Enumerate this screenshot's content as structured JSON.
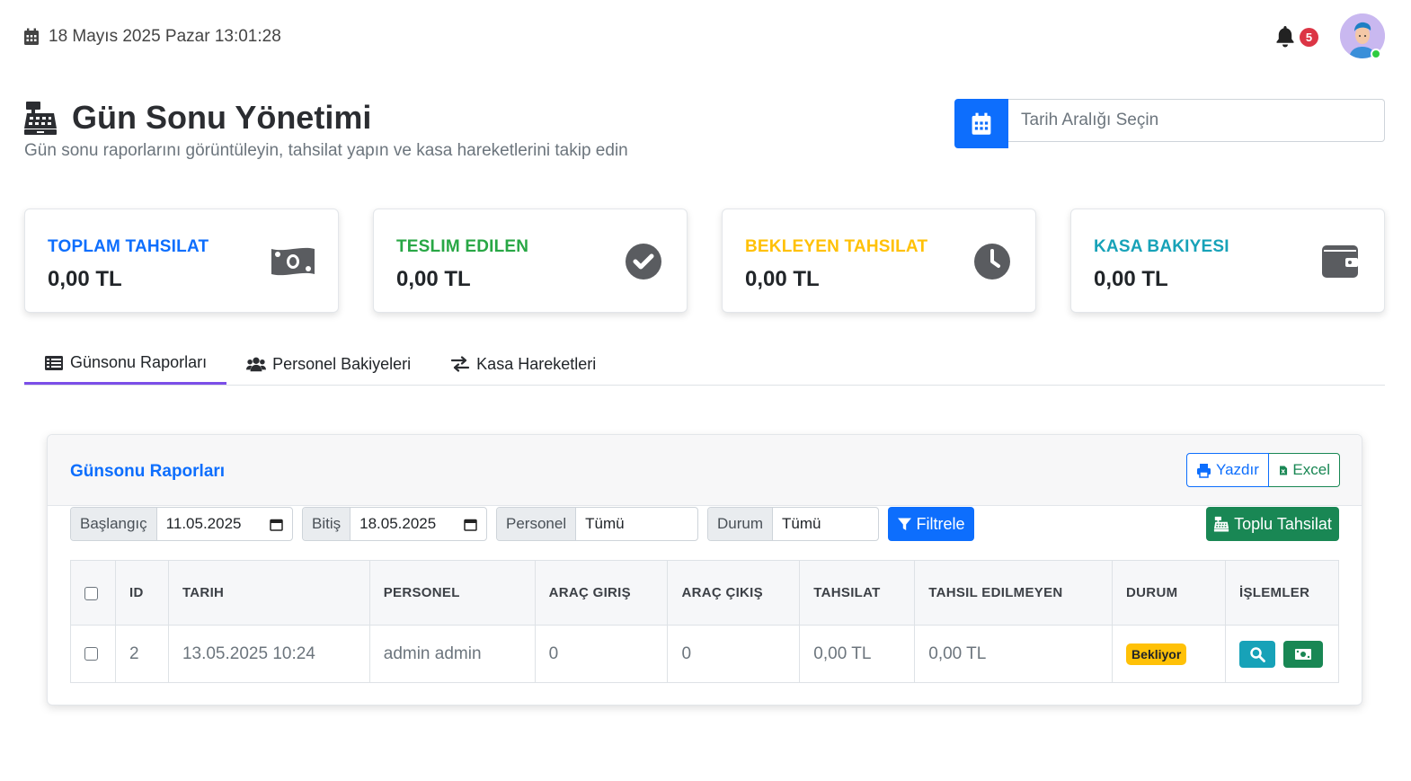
{
  "topbar": {
    "datetime": "18 Mayıs 2025 Pazar 13:01:28",
    "notification_count": "5"
  },
  "header": {
    "title": "Gün Sonu Yönetimi",
    "subtitle": "Gün sonu raporlarını görüntüleyin, tahsilat yapın ve kasa hareketlerini takip edin",
    "date_range_placeholder": "Tarih Aralığı Seçin"
  },
  "stats": [
    {
      "label": "TOPLAM TAHSILAT",
      "value": "0,00 TL",
      "color": "#0d6efd",
      "icon": "money-bill-icon"
    },
    {
      "label": "TESLIM EDILEN",
      "value": "0,00 TL",
      "color": "#28a745",
      "icon": "check-circle-icon"
    },
    {
      "label": "BEKLEYEN TAHSILAT",
      "value": "0,00 TL",
      "color": "#ffc107",
      "icon": "clock-icon"
    },
    {
      "label": "KASA BAKIYESI",
      "value": "0,00 TL",
      "color": "#17a2b8",
      "icon": "wallet-icon"
    }
  ],
  "tabs": [
    {
      "label": "Günsonu Raporları",
      "icon": "list-icon",
      "active": true
    },
    {
      "label": "Personel Bakiyeleri",
      "icon": "users-icon",
      "active": false
    },
    {
      "label": "Kasa Hareketleri",
      "icon": "exchange-icon",
      "active": false
    }
  ],
  "panel": {
    "title": "Günsonu Raporları",
    "print_label": "Yazdır",
    "excel_label": "Excel",
    "filters": {
      "start_label": "Başlangıç",
      "start_value": "11.05.2025",
      "end_label": "Bitiş",
      "end_value": "18.05.2025",
      "personnel_label": "Personel",
      "personnel_value": "Tümü",
      "status_label": "Durum",
      "status_value": "Tümü"
    },
    "filter_button": "Filtrele",
    "bulk_button": "Toplu Tahsilat"
  },
  "table": {
    "headers": [
      "ID",
      "TARIH",
      "PERSONEL",
      "ARAÇ GIRIŞ",
      "ARAÇ ÇIKIŞ",
      "TAHSILAT",
      "TAHSIL EDILMEYEN",
      "DURUM",
      "İŞLEMLER"
    ],
    "rows": [
      {
        "id": "2",
        "date": "13.05.2025 10:24",
        "personnel": "admin admin",
        "in": "0",
        "out": "0",
        "collected": "0,00 TL",
        "uncollected": "0,00 TL",
        "status": "Bekliyor"
      }
    ]
  },
  "colors": {
    "primary": "#0d6efd",
    "success": "#198754",
    "warning": "#ffc107",
    "info": "#17a2b8",
    "tab_active": "#7b4ee8"
  }
}
